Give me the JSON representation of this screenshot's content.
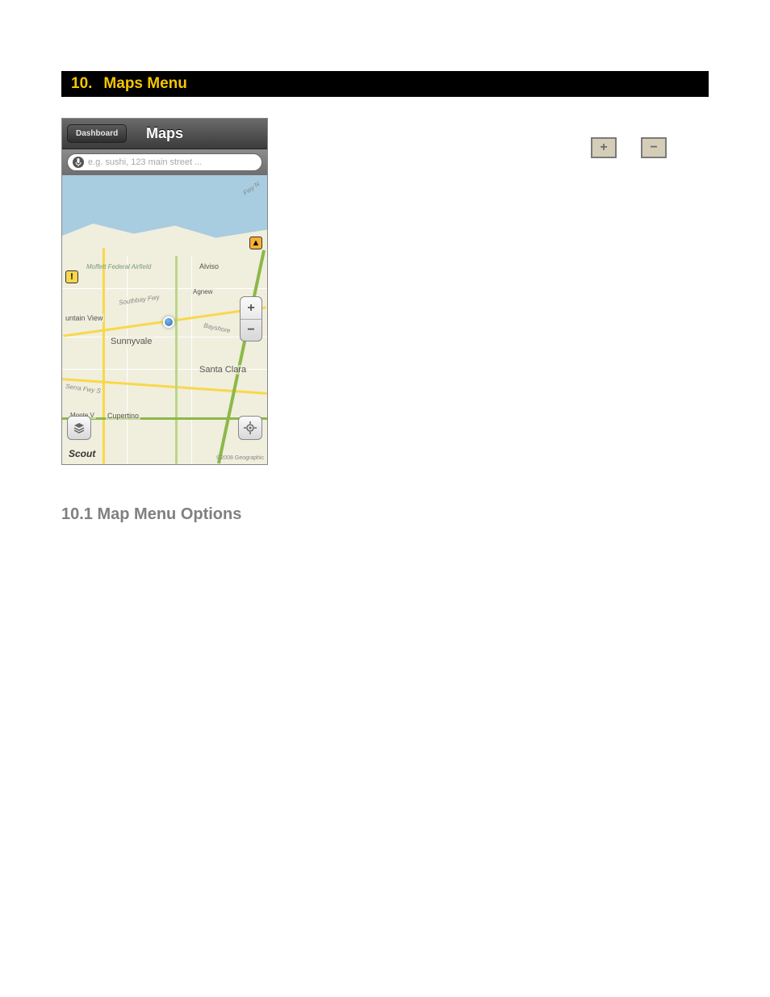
{
  "section": {
    "number": "10.",
    "title": "Maps Menu"
  },
  "phone": {
    "back_button": "Dashboard",
    "title": "Maps",
    "search_placeholder": "e.g. sushi, 123 main street ...",
    "zoom_in": "+",
    "zoom_out": "−",
    "scout": "Scout",
    "copyright": "©2008 Geographic",
    "cities": {
      "alviso": "Alviso",
      "sunnyvale": "Sunnyvale",
      "santa_clara": "Santa Clara",
      "cupertino": "Cupertino",
      "mountain_view": "untain View",
      "monte": "Monte V",
      "agnew": "Agnew",
      "moffett": "Moffett Federal Airfield"
    },
    "roads": {
      "southbay": "Southbay Fwy",
      "bayshore": "Bayshore",
      "serra": "Serra Fwy S",
      "fwy_n": "Fwy N"
    },
    "warning": "!"
  },
  "doc_buttons": {
    "plus": "+",
    "minus": "−"
  },
  "subsection": {
    "title": "10.1 Map Menu Options"
  }
}
